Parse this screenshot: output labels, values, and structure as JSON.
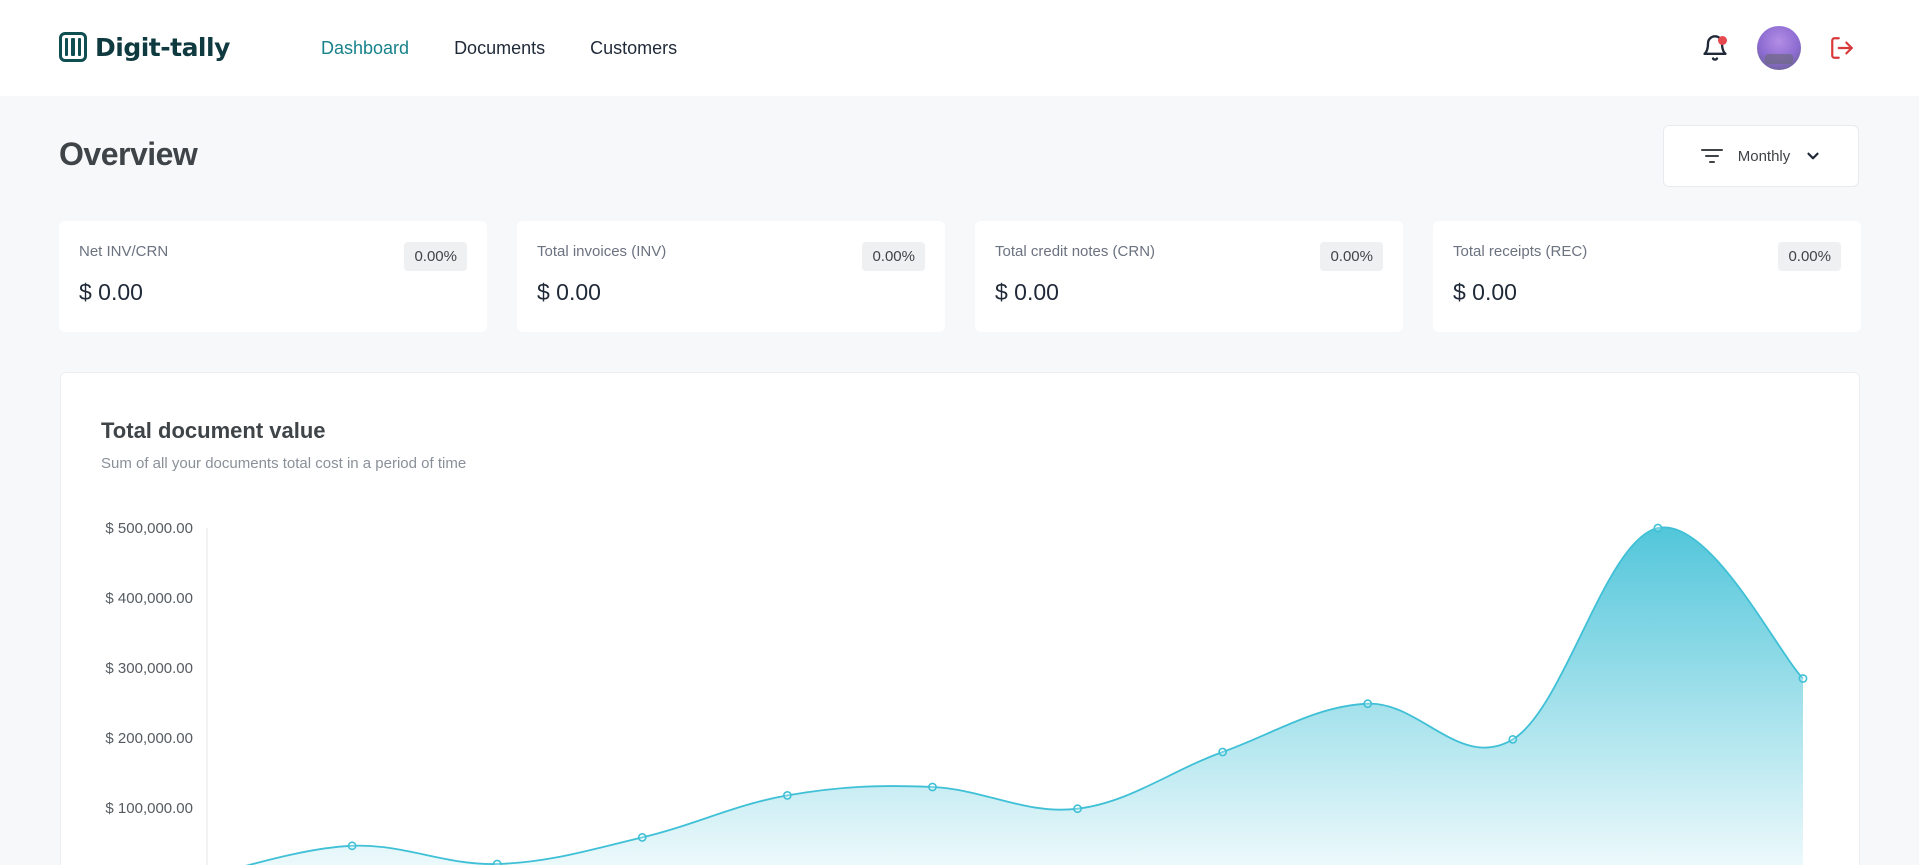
{
  "header": {
    "logo_text": "Digit-tally",
    "nav": [
      {
        "label": "Dashboard",
        "active": true
      },
      {
        "label": "Documents",
        "active": false
      },
      {
        "label": "Customers",
        "active": false
      }
    ],
    "icons": [
      "bell-icon",
      "avatar",
      "logout-icon"
    ],
    "notification_dot": true
  },
  "page": {
    "title": "Overview",
    "period_select": {
      "value": "Monthly"
    }
  },
  "stats": [
    {
      "label": "Net INV/CRN",
      "value": "$ 0.00",
      "change": "0.00%"
    },
    {
      "label": "Total invoices (INV)",
      "value": "$ 0.00",
      "change": "0.00%"
    },
    {
      "label": "Total credit notes (CRN)",
      "value": "$ 0.00",
      "change": "0.00%"
    },
    {
      "label": "Total receipts (REC)",
      "value": "$ 0.00",
      "change": "0.00%"
    }
  ],
  "colors": {
    "accent": "#17828a",
    "series": "#3fc0d6",
    "alert": "#e5484d",
    "logout": "#d9383a"
  },
  "chart_data": {
    "type": "area",
    "title": "Total document value",
    "subtitle": "Sum of all your documents total cost in a period of time",
    "y_tick_labels": [
      "$ 500,000.00",
      "$ 400,000.00",
      "$ 300,000.00",
      "$ 200,000.00",
      "$ 100,000.00"
    ],
    "y_ticks": [
      500000,
      400000,
      300000,
      200000,
      100000
    ],
    "ylim": [
      0,
      500000
    ],
    "series": [
      {
        "values": [
          3000,
          46000,
          20000,
          58000,
          118000,
          130000,
          99000,
          180000,
          249000,
          198000,
          500000,
          285000
        ]
      }
    ],
    "grid": false,
    "legend": "none"
  }
}
